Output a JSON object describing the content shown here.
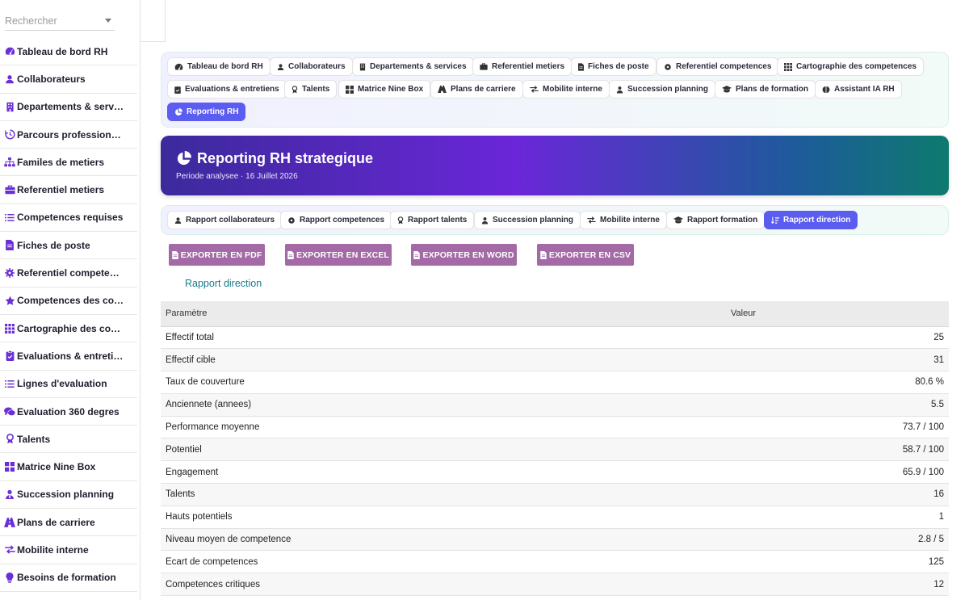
{
  "search": {
    "placeholder": "Rechercher"
  },
  "sidebar": {
    "items": [
      {
        "label": "Tableau de bord RH",
        "icon": "dashboard-icon"
      },
      {
        "label": "Collaborateurs",
        "icon": "user-icon"
      },
      {
        "label": "Departements & serv…",
        "icon": "building-icon"
      },
      {
        "label": "Parcours profession…",
        "icon": "history-icon"
      },
      {
        "label": "Familes de metiers",
        "icon": "sitemap-icon"
      },
      {
        "label": "Referentiel metiers",
        "icon": "briefcase-icon"
      },
      {
        "label": "Competences requises",
        "icon": "list-icon"
      },
      {
        "label": "Fiches de poste",
        "icon": "file-icon"
      },
      {
        "label": "Referentiel compete…",
        "icon": "gear-icon"
      },
      {
        "label": "Competences des co…",
        "icon": "star-icon"
      },
      {
        "label": "Cartographie des co…",
        "icon": "grid-icon"
      },
      {
        "label": "Evaluations & entreti…",
        "icon": "clipboard-icon"
      },
      {
        "label": "Lignes d'evaluation",
        "icon": "list-icon"
      },
      {
        "label": "Evaluation 360 degres",
        "icon": "comments-icon"
      },
      {
        "label": "Talents",
        "icon": "award-icon"
      },
      {
        "label": "Matrice Nine Box",
        "icon": "grid-icon"
      },
      {
        "label": "Succession planning",
        "icon": "user-tie-icon"
      },
      {
        "label": "Plans de carriere",
        "icon": "road-icon"
      },
      {
        "label": "Mobilite interne",
        "icon": "exchange-icon"
      },
      {
        "label": "Besoins de formation",
        "icon": "lightbulb-icon"
      }
    ]
  },
  "nav": {
    "row1": [
      "Tableau de bord RH",
      "Collaborateurs",
      "Departements & services",
      "Referentiel metiers",
      "Fiches de poste",
      "Referentiel competences",
      "Cartographie des competences"
    ],
    "row2": [
      "Evaluations & entretiens",
      "Talents",
      "Matrice Nine Box",
      "Plans de carriere",
      "Mobilite interne",
      "Succession planning",
      "Plans de formation",
      "Assistant IA RH"
    ],
    "row3": [
      "Reporting RH"
    ]
  },
  "banner": {
    "title": "Reporting RH strategique",
    "subtitle": "Periode analysee · 16 Juillet 2026"
  },
  "report_tabs": [
    "Rapport collaborateurs",
    "Rapport competences",
    "Rapport talents",
    "Succession planning",
    "Mobilite interne",
    "Rapport formation",
    "Rapport direction"
  ],
  "exports": [
    "EXPORTER EN PDF",
    "EXPORTER EN EXCEL",
    "EXPORTER EN WORD",
    "EXPORTER EN CSV"
  ],
  "section_title": "Rapport direction",
  "table": {
    "headers": [
      "Paramètre",
      "Valeur"
    ],
    "rows": [
      [
        "Effectif total",
        "25"
      ],
      [
        "Effectif cible",
        "31"
      ],
      [
        "Taux de couverture",
        "80.6 %"
      ],
      [
        "Anciennete (annees)",
        "5.5"
      ],
      [
        "Performance moyenne",
        "73.7 / 100"
      ],
      [
        "Potentiel",
        "58.7 / 100"
      ],
      [
        "Engagement",
        "65.9 / 100"
      ],
      [
        "Talents",
        "16"
      ],
      [
        "Hauts potentiels",
        "1"
      ],
      [
        "Niveau moyen de competence",
        "2.8 / 5"
      ],
      [
        "Ecart de competences",
        "125"
      ],
      [
        "Competences critiques",
        "12"
      ]
    ]
  },
  "colors": {
    "accent": "#5b5cf0",
    "sidebar_icon": "#6a2fd6",
    "export": "#a36aa6",
    "section_title": "#1a7a8a"
  }
}
